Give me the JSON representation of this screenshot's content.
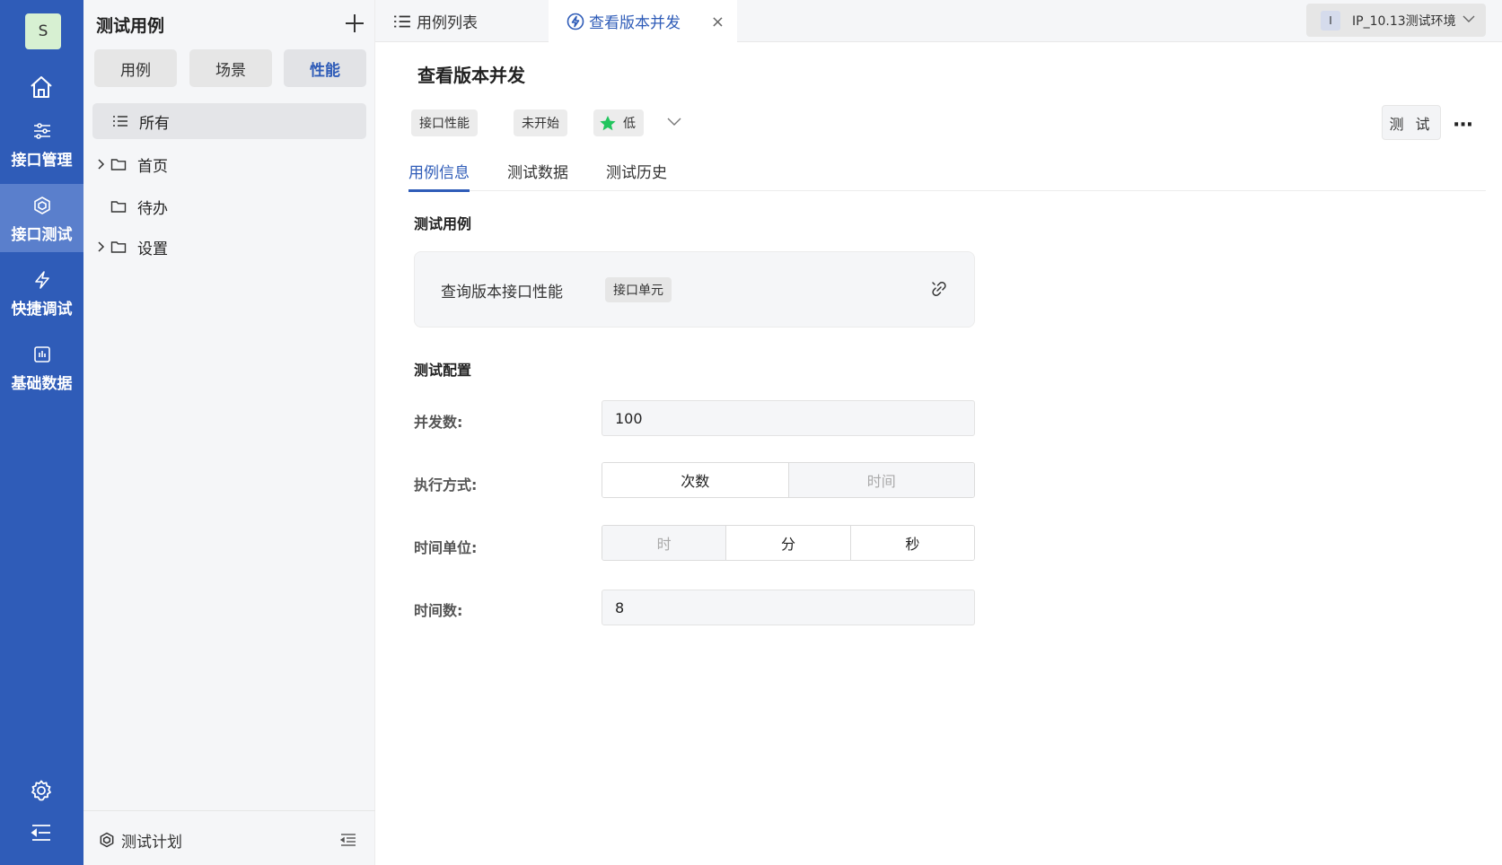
{
  "nav": {
    "avatar": "S",
    "items": [
      {
        "label": "接口管理"
      },
      {
        "label": "接口测试"
      },
      {
        "label": "快捷调试"
      },
      {
        "label": "基础数据"
      }
    ]
  },
  "tree": {
    "title": "测试用例",
    "segments": [
      "用例",
      "场景",
      "性能"
    ],
    "rows": [
      "所有",
      "首页",
      "待办",
      "设置"
    ],
    "footer": "测试计划"
  },
  "tabs": {
    "list": "用例列表",
    "current": "查看版本并发",
    "close": "×"
  },
  "env": {
    "badge": "I",
    "name": "IP_10.13测试环境"
  },
  "main": {
    "title": "查看版本并发",
    "chips": {
      "type": "接口性能",
      "status": "未开始",
      "priority": "低"
    },
    "test_button": "测 试",
    "more": "···",
    "subtabs": [
      "用例信息",
      "测试数据",
      "测试历史"
    ],
    "section_case": "测试用例",
    "case": {
      "name": "查询版本接口性能",
      "tag": "接口单元"
    },
    "section_config": "测试配置",
    "form": {
      "concurrency_label": "并发数:",
      "concurrency_value": "100",
      "exec_label": "执行方式:",
      "exec_options": [
        "次数",
        "时间"
      ],
      "unit_label": "时间单位:",
      "unit_options": [
        "时",
        "分",
        "秒"
      ],
      "duration_label": "时间数:",
      "duration_value": "8"
    }
  },
  "colors": {
    "primary": "#2f5cb8",
    "priority_star": "#22c55e"
  }
}
